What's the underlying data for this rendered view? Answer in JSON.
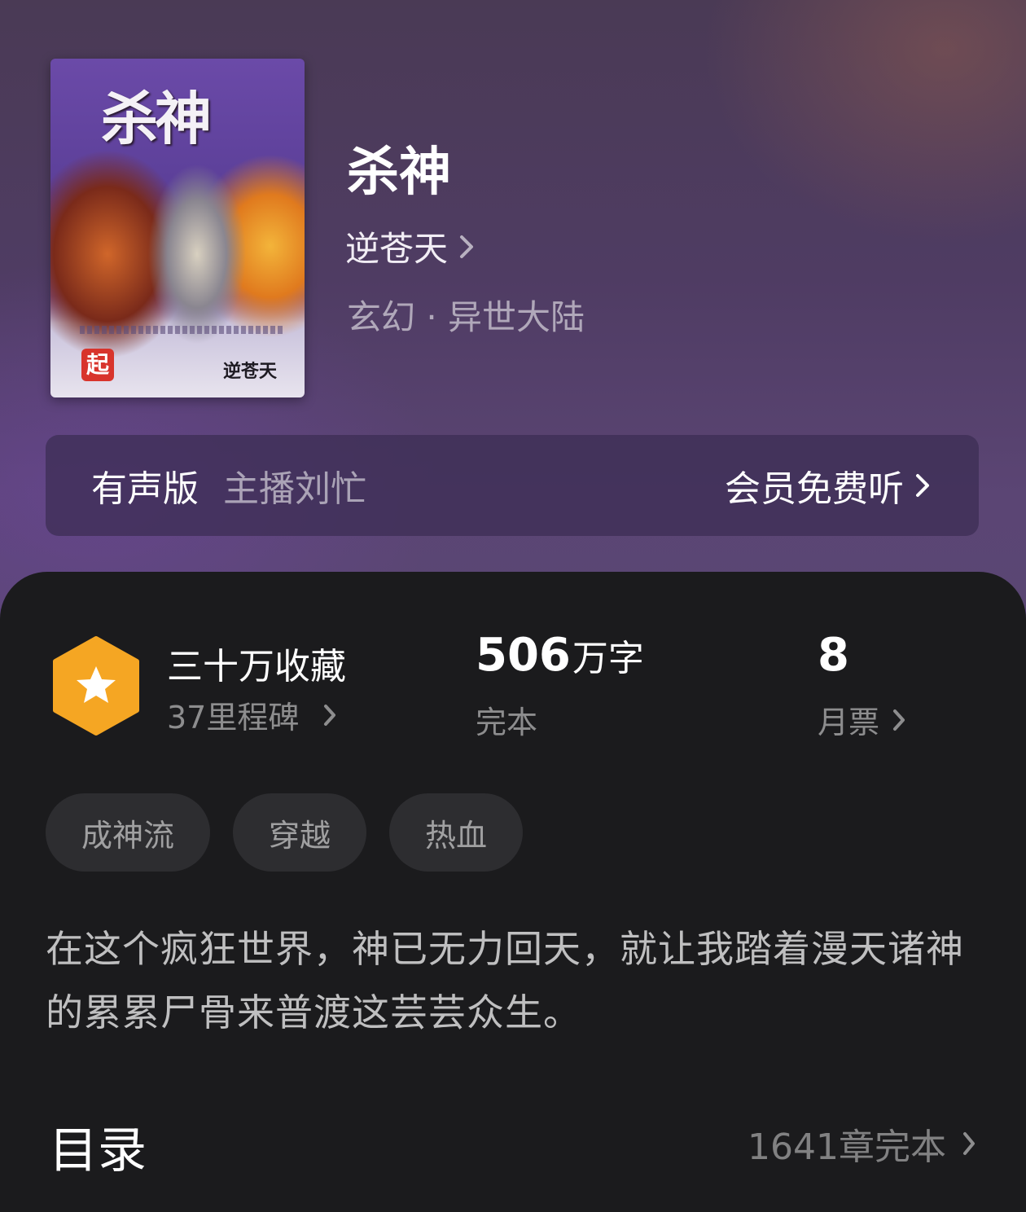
{
  "book": {
    "cover_title": "杀神",
    "cover_badge": "起",
    "cover_author": "逆苍天",
    "title": "杀神",
    "author": "逆苍天",
    "genre": "玄幻 · 异世大陆"
  },
  "audio": {
    "label": "有声版",
    "anchor": "主播刘忙",
    "action": "会员免费听"
  },
  "stats": {
    "favorites": "三十万收藏",
    "milestones": "37里程碑",
    "word_count": "506",
    "word_unit": "万字",
    "status": "完本",
    "monthly_votes": "8",
    "monthly_votes_label": "月票"
  },
  "tags": [
    "成神流",
    "穿越",
    "热血"
  ],
  "description": "在这个疯狂世界，神已无力回天，就让我踏着漫天诸神的累累尸骨来普渡这芸芸众生。",
  "toc": {
    "title": "目录",
    "info": "1641章完本"
  },
  "colors": {
    "badge_hex": "#f5a623",
    "panel_bg": "#1b1b1d",
    "tag_bg": "#2d2d30"
  }
}
